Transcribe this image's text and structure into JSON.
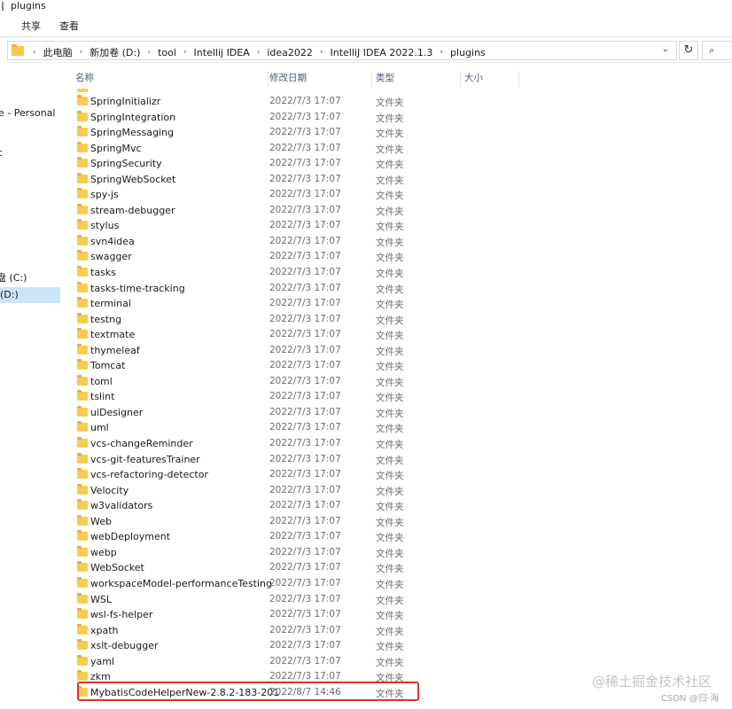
{
  "window": {
    "title": "plugins"
  },
  "ribbon": {
    "tabs": [
      "共享",
      "查看"
    ]
  },
  "address": {
    "crumbs": [
      "此电脑",
      "新加卷 (D:)",
      "tool",
      "Intellij IDEA",
      "idea2022",
      "IntelliJ IDEA 2022.1.3",
      "plugins"
    ],
    "dropdown_icon": "chevron-down-icon",
    "refresh_icon": "refresh-icon",
    "refresh_glyph": "↻",
    "search_icon": "search-icon"
  },
  "nav": {
    "items": [
      "e - Personal",
      "t",
      "盘 (C:)",
      "(D:)"
    ]
  },
  "columns": {
    "name": "名称",
    "date": "修改日期",
    "type": "类型",
    "size": "大小"
  },
  "files": [
    {
      "name": "",
      "date": "",
      "type": ""
    },
    {
      "name": "SpringInitializr",
      "date": "2022/7/3 17:07",
      "type": "文件夹"
    },
    {
      "name": "SpringIntegration",
      "date": "2022/7/3 17:07",
      "type": "文件夹"
    },
    {
      "name": "SpringMessaging",
      "date": "2022/7/3 17:07",
      "type": "文件夹"
    },
    {
      "name": "SpringMvc",
      "date": "2022/7/3 17:07",
      "type": "文件夹"
    },
    {
      "name": "SpringSecurity",
      "date": "2022/7/3 17:07",
      "type": "文件夹"
    },
    {
      "name": "SpringWebSocket",
      "date": "2022/7/3 17:07",
      "type": "文件夹"
    },
    {
      "name": "spy-js",
      "date": "2022/7/3 17:07",
      "type": "文件夹"
    },
    {
      "name": "stream-debugger",
      "date": "2022/7/3 17:07",
      "type": "文件夹"
    },
    {
      "name": "stylus",
      "date": "2022/7/3 17:07",
      "type": "文件夹"
    },
    {
      "name": "svn4idea",
      "date": "2022/7/3 17:07",
      "type": "文件夹"
    },
    {
      "name": "swagger",
      "date": "2022/7/3 17:07",
      "type": "文件夹"
    },
    {
      "name": "tasks",
      "date": "2022/7/3 17:07",
      "type": "文件夹"
    },
    {
      "name": "tasks-time-tracking",
      "date": "2022/7/3 17:07",
      "type": "文件夹"
    },
    {
      "name": "terminal",
      "date": "2022/7/3 17:07",
      "type": "文件夹"
    },
    {
      "name": "testng",
      "date": "2022/7/3 17:07",
      "type": "文件夹"
    },
    {
      "name": "textmate",
      "date": "2022/7/3 17:07",
      "type": "文件夹"
    },
    {
      "name": "thymeleaf",
      "date": "2022/7/3 17:07",
      "type": "文件夹"
    },
    {
      "name": "Tomcat",
      "date": "2022/7/3 17:07",
      "type": "文件夹"
    },
    {
      "name": "toml",
      "date": "2022/7/3 17:07",
      "type": "文件夹"
    },
    {
      "name": "tslint",
      "date": "2022/7/3 17:07",
      "type": "文件夹"
    },
    {
      "name": "uiDesigner",
      "date": "2022/7/3 17:07",
      "type": "文件夹"
    },
    {
      "name": "uml",
      "date": "2022/7/3 17:07",
      "type": "文件夹"
    },
    {
      "name": "vcs-changeReminder",
      "date": "2022/7/3 17:07",
      "type": "文件夹"
    },
    {
      "name": "vcs-git-featuresTrainer",
      "date": "2022/7/3 17:07",
      "type": "文件夹"
    },
    {
      "name": "vcs-refactoring-detector",
      "date": "2022/7/3 17:07",
      "type": "文件夹"
    },
    {
      "name": "Velocity",
      "date": "2022/7/3 17:07",
      "type": "文件夹"
    },
    {
      "name": "w3validators",
      "date": "2022/7/3 17:07",
      "type": "文件夹"
    },
    {
      "name": "Web",
      "date": "2022/7/3 17:07",
      "type": "文件夹"
    },
    {
      "name": "webDeployment",
      "date": "2022/7/3 17:07",
      "type": "文件夹"
    },
    {
      "name": "webp",
      "date": "2022/7/3 17:07",
      "type": "文件夹"
    },
    {
      "name": "WebSocket",
      "date": "2022/7/3 17:07",
      "type": "文件夹"
    },
    {
      "name": "workspaceModel-performanceTesting",
      "date": "2022/7/3 17:07",
      "type": "文件夹"
    },
    {
      "name": "WSL",
      "date": "2022/7/3 17:07",
      "type": "文件夹"
    },
    {
      "name": "wsl-fs-helper",
      "date": "2022/7/3 17:07",
      "type": "文件夹"
    },
    {
      "name": "xpath",
      "date": "2022/7/3 17:07",
      "type": "文件夹"
    },
    {
      "name": "xslt-debugger",
      "date": "2022/7/3 17:07",
      "type": "文件夹"
    },
    {
      "name": "yaml",
      "date": "2022/7/3 17:07",
      "type": "文件夹"
    },
    {
      "name": "zkm",
      "date": "2022/7/3 17:07",
      "type": "文件夹"
    },
    {
      "name": "MybatisCodeHelperNew-2.8.2-183-201",
      "date": "2022/8/7 14:46",
      "type": "文件夹"
    }
  ],
  "highlight": {
    "color": "#e0322c"
  },
  "watermark": {
    "main": "@稀土掘金技术社区",
    "sub": "CSDN @归-海"
  },
  "colors": {
    "folder": "#f8cb52",
    "selected_nav": "#cce4f7",
    "header_text": "#4a5a78"
  }
}
